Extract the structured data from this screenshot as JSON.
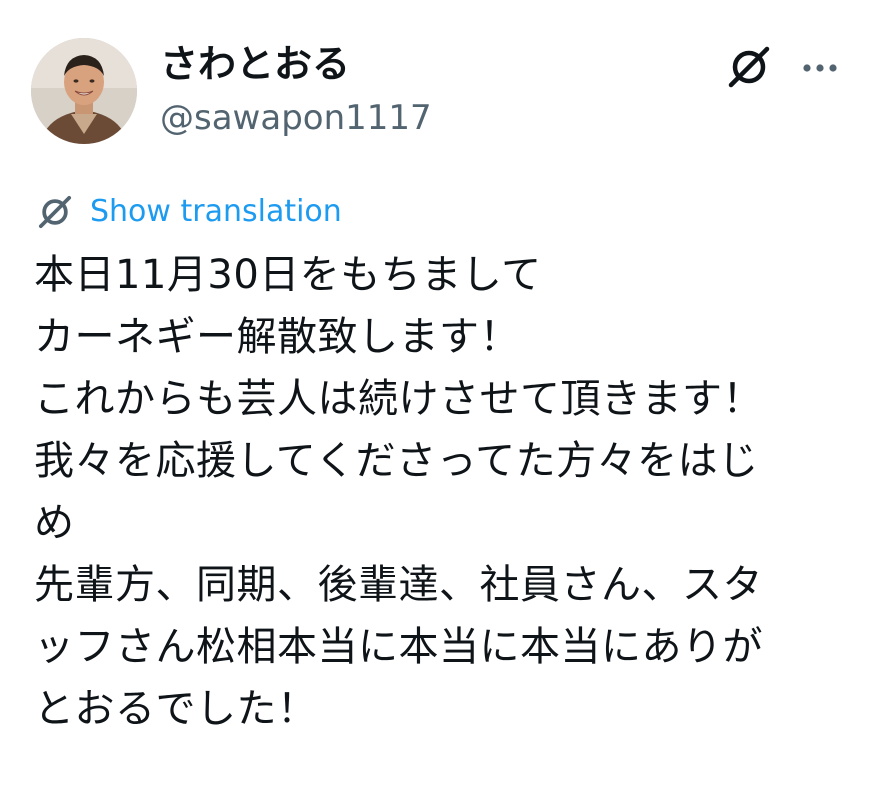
{
  "author": {
    "display_name": "さわとおる",
    "handle": "@sawapon1117"
  },
  "icons": {
    "grok": "grok-icon",
    "more": "more-dots-icon",
    "translate": "grok-translate-icon"
  },
  "translate": {
    "label": "Show translation"
  },
  "tweet": {
    "lines": [
      "本日11月30日をもちまして",
      "カーネギー解散致します！",
      "これからも芸人は続けさせて頂きます！",
      "我々を応援してくださってた方々をはじ",
      "め",
      "先輩方、同期、後輩達、社員さん、スタ",
      "ッフさん松相本当に本当に本当にありが",
      "とおるでした！"
    ]
  },
  "colors": {
    "text": "#0f1419",
    "secondary": "#536471",
    "link": "#1d9bf0"
  }
}
